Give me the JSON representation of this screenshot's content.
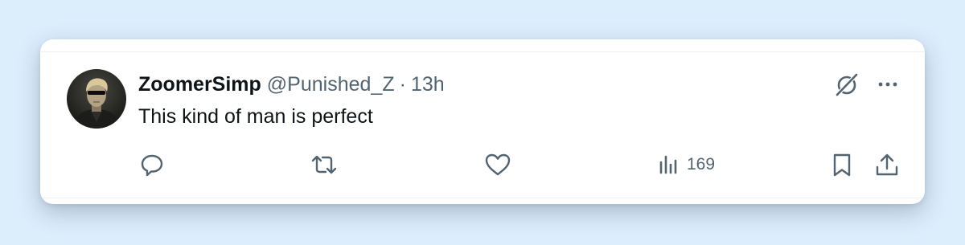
{
  "tweet": {
    "display_name": "ZoomerSimp",
    "handle": "@Punished_Z",
    "separator": "·",
    "time": "13h",
    "text": "This kind of man is perfect",
    "avatar_icon": "avatar-photo-man-with-sunglasses"
  },
  "actions": {
    "reply_icon": "reply-icon",
    "retweet_icon": "retweet-icon",
    "like_icon": "heart-icon",
    "views_icon": "bar-chart-icon",
    "views_count": "169",
    "bookmark_icon": "bookmark-icon",
    "share_icon": "share-icon"
  },
  "header_icons": {
    "grok_icon": "grok-icon",
    "more_icon": "more-icon"
  },
  "colors": {
    "background": "#dcedfc",
    "card": "#ffffff",
    "primary_text": "#0f1419",
    "secondary_text": "#536471"
  }
}
